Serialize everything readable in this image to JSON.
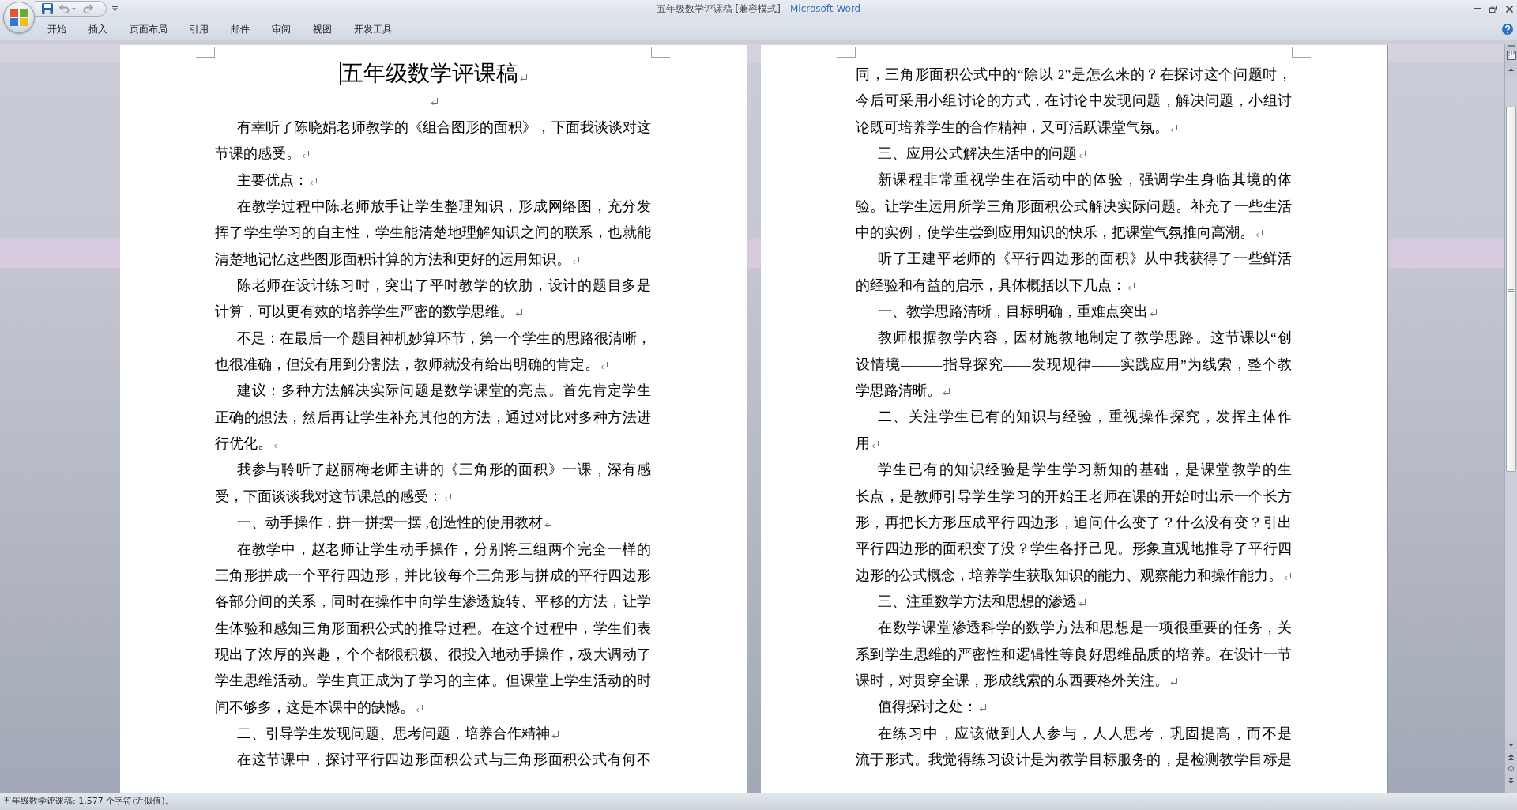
{
  "window": {
    "document_name": "五年级数学评课稿 [兼容模式]",
    "separator": "-",
    "app_name": "Microsoft Word"
  },
  "quick_access": [
    {
      "kind": "save",
      "disabled": false
    },
    {
      "kind": "undo",
      "disabled": true
    },
    {
      "kind": "redo",
      "disabled": true
    },
    {
      "kind": "customize",
      "disabled": false
    }
  ],
  "ribbon_tabs": [
    {
      "label": "开始",
      "selected": false
    },
    {
      "label": "插入",
      "selected": false
    },
    {
      "label": "页面布局",
      "selected": false
    },
    {
      "label": "引用",
      "selected": false
    },
    {
      "label": "邮件",
      "selected": false
    },
    {
      "label": "审阅",
      "selected": false
    },
    {
      "label": "视图",
      "selected": false
    },
    {
      "label": "开发工具",
      "selected": false
    }
  ],
  "pages": [
    {
      "title": {
        "text": "五年级数学评课稿",
        "cursor": true,
        "end_mark": true
      },
      "paragraphs": [
        {
          "kind": "blank",
          "end_mark": true
        },
        {
          "kind": "body",
          "lines": [
            "有幸听了陈晓娟老师教学的《组合图形的面积》，下面我谈谈对这",
            "节课的感受。"
          ],
          "end_mark": true
        },
        {
          "kind": "body",
          "lines": [
            "主要优点："
          ],
          "end_mark": true
        },
        {
          "kind": "body",
          "lines": [
            "在教学过程中陈老师放手让学生整理知识，形成网络图，充分发",
            "挥了学生学习的自主性，学生能清楚地理解知识之间的联系，也就能",
            "清楚地记忆这些图形面积计算的方法和更好的运用知识。"
          ],
          "end_mark": true
        },
        {
          "kind": "body",
          "lines": [
            "陈老师在设计练习时，突出了平时教学的软肋，设计的题目多是",
            "计算，可以更有效的培养学生严密的数学思维。"
          ],
          "end_mark": true
        },
        {
          "kind": "body",
          "lines": [
            "不足：在最后一个题目神机妙算环节，第一个学生的思路很清晰，",
            "也很准确，但没有用到分割法，教师就没有给出明确的肯定。"
          ],
          "end_mark": true
        },
        {
          "kind": "body",
          "lines": [
            "建议：多种方法解决实际问题是数学课堂的亮点。首先肯定学生",
            "正确的想法，然后再让学生补充其他的方法，通过对比对多种方法进",
            "行优化。"
          ],
          "end_mark": true
        },
        {
          "kind": "body",
          "lines": [
            "我参与聆听了赵丽梅老师主讲的《三角形的面积》一课，深有感",
            "受，下面谈谈我对这节课总的感受："
          ],
          "end_mark": true
        },
        {
          "kind": "body",
          "lines": [
            "一、动手操作，拼一拼摆一摆 ,创造性的使用教材"
          ],
          "end_mark": true
        },
        {
          "kind": "body",
          "lines": [
            "在教学中，赵老师让学生动手操作，分别将三组两个完全一样的",
            "三角形拼成一个平行四边形，并比较每个三角形与拼成的平行四边形",
            "各部分间的关系，同时在操作中向学生渗透旋转、平移的方法，让学",
            "生体验和感知三角形面积公式的推导过程。在这个过程中，学生们表",
            "现出了浓厚的兴趣，个个都很积极、很投入地动手操作，极大调动了",
            "学生思维活动。学生真正成为了学习的主体。但课堂上学生活动的时",
            "间不够多，这是本课中的缺憾。"
          ],
          "end_mark": true
        },
        {
          "kind": "body",
          "lines": [
            "二、引导学生发现问题、思考问题，培养合作精神"
          ],
          "end_mark": true
        },
        {
          "kind": "body",
          "lines": [
            "在这节课中，探讨平行四边形面积公式与三角形面积公式有何不"
          ],
          "end_mark": false
        }
      ]
    },
    {
      "paragraphs": [
        {
          "kind": "continuation",
          "lines": [
            "同，三角形面积公式中的“除以 2”是怎么来的？在探讨这个问题时，",
            "今后可采用小组讨论的方式，在讨论中发现问题，解决问题，小组讨",
            "论既可培养学生的合作精神，又可活跃课堂气氛。"
          ],
          "end_mark": true
        },
        {
          "kind": "body",
          "lines": [
            "三、应用公式解决生活中的问题"
          ],
          "end_mark": true
        },
        {
          "kind": "body",
          "lines": [
            "新课程非常重视学生在活动中的体验，强调学生身临其境的体",
            "验。让学生运用所学三角形面积公式解决实际问题。补充了一些生活",
            "中的实例，使学生尝到应用知识的快乐，把课堂气氛推向高潮。"
          ],
          "end_mark": true
        },
        {
          "kind": "body",
          "lines": [
            "听了王建平老师的《平行四边形的面积》从中我获得了一些鲜活",
            "的经验和有益的启示，具体概括以下几点："
          ],
          "end_mark": true
        },
        {
          "kind": "body",
          "lines": [
            "一、教学思路清晰，目标明确，重难点突出"
          ],
          "end_mark": true
        },
        {
          "kind": "body",
          "lines": [
            "教师根据教学内容，因材施教地制定了教学思路。这节课以“创",
            "设情境———指导探究——发现规律——实践应用”为线索，整个教",
            "学思路清晰。"
          ],
          "end_mark": true
        },
        {
          "kind": "body",
          "lines": [
            "二、关注学生已有的知识与经验，重视操作探究，发挥主体作",
            "用"
          ],
          "end_mark": true
        },
        {
          "kind": "body",
          "lines": [
            "学生已有的知识经验是学生学习新知的基础，是课堂教学的生",
            "长点，是教师引导学生学习的开始王老师在课的开始时出示一个长方",
            "形，再把长方形压成平行四边形，追问什么变了？什么没有变？引出",
            "平行四边形的面积变了没？学生各抒己见。形象直观地推导了平行四",
            "边形的公式概念，培养学生获取知识的能力、观察能力和操作能力。"
          ],
          "end_mark": true
        },
        {
          "kind": "body",
          "lines": [
            "三、注重数学方法和思想的渗透"
          ],
          "end_mark": true
        },
        {
          "kind": "body",
          "lines": [
            "在数学课堂渗透科学的数学方法和思想是一项很重要的任务，关",
            "系到学生思维的严密性和逻辑性等良好思维品质的培养。在设计一节",
            "课时，对贯穿全课，形成线索的东西要格外关注。"
          ],
          "end_mark": true
        },
        {
          "kind": "body",
          "lines": [
            "值得探讨之处："
          ],
          "end_mark": true
        },
        {
          "kind": "body",
          "lines": [
            "在练习中，应该做到人人参与，人人思考，巩固提高，而不是",
            "流于形式。我觉得练习设计是为教学目标服务的，是检测教学目标是"
          ],
          "end_mark": false
        }
      ]
    }
  ],
  "status_bar": {
    "text": "五年级数学评课稿: 1,577 个字符(近似值)。"
  }
}
